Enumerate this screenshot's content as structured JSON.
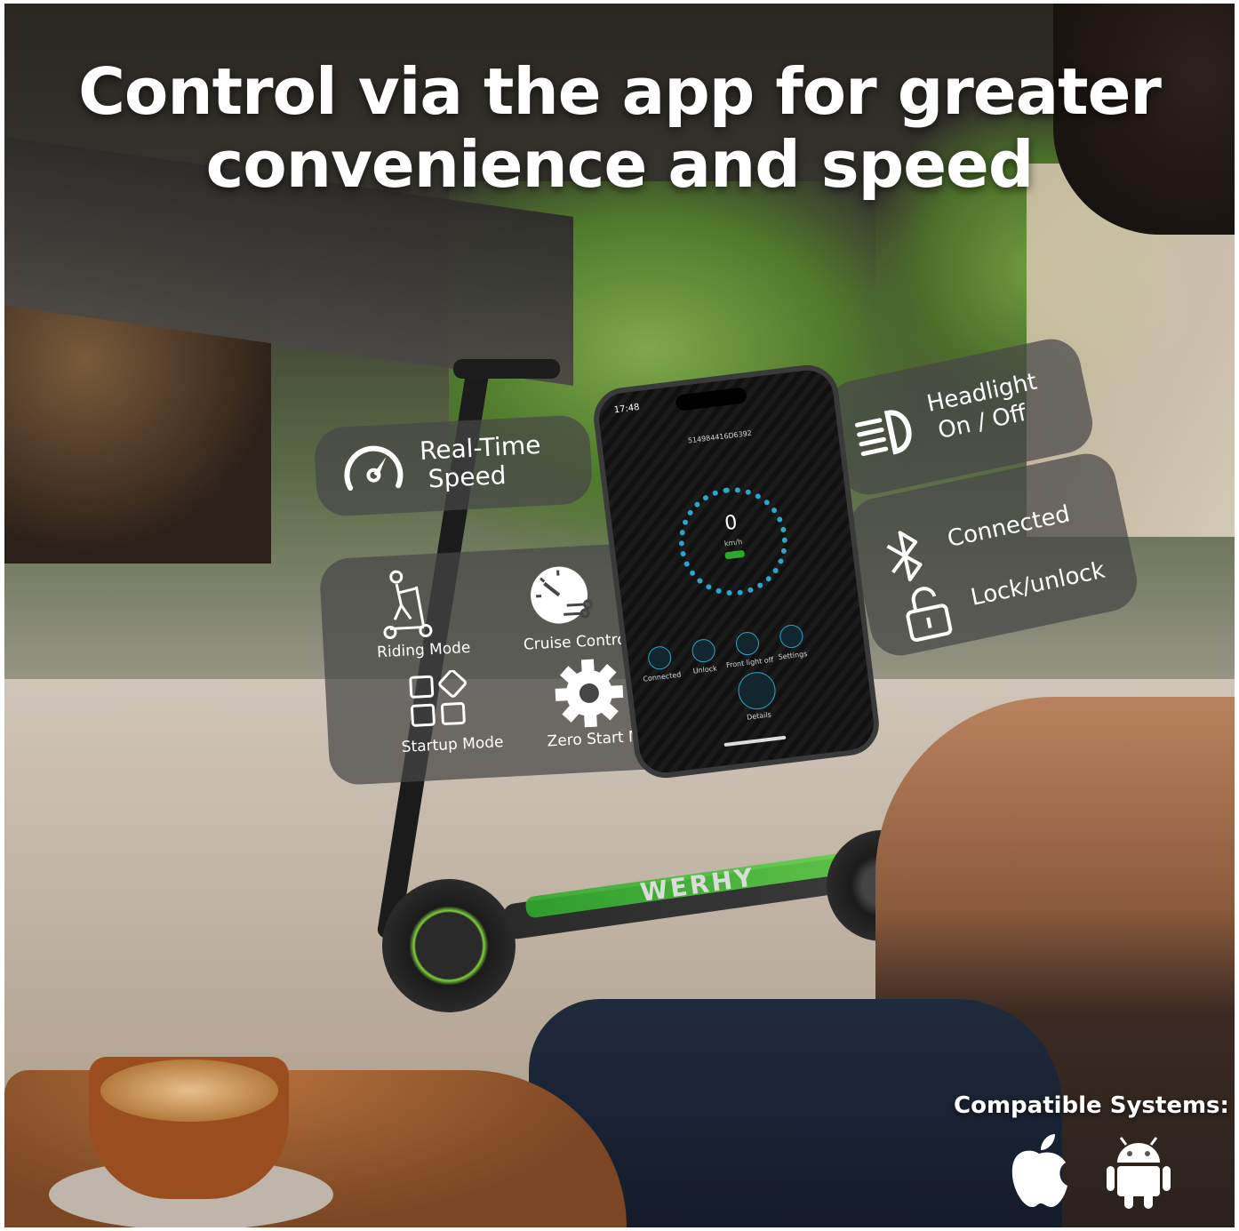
{
  "headline": {
    "line1": "Control via the app for greater",
    "line2": "convenience and speed"
  },
  "features": {
    "speed": {
      "line1": "Real-Time",
      "line2": "Speed"
    },
    "riding_mode": "Riding Mode",
    "cruise_control": "Cruise Control",
    "startup_mode": "Startup Mode",
    "zero_start_mode": "Zero Start Mode",
    "headlight": {
      "line1": "Headlight",
      "line2": "On / Off"
    },
    "connected": "Connected",
    "lock_unlock": "Lock/unlock"
  },
  "phone": {
    "time": "17:48",
    "device_id": "514984416D6392",
    "speed_value": "0",
    "speed_unit": "km/h",
    "buttons": [
      "Connected",
      "Unlock",
      "Front light off",
      "Settings"
    ],
    "details": "Details"
  },
  "scooter_brand": "WERHY",
  "compatibility": {
    "title": "Compatible Systems:",
    "icons": [
      "apple-icon",
      "android-icon"
    ]
  },
  "colors": {
    "panel": "#464646",
    "accent_green": "#62d14a",
    "app_accent": "#2aa7c9"
  }
}
